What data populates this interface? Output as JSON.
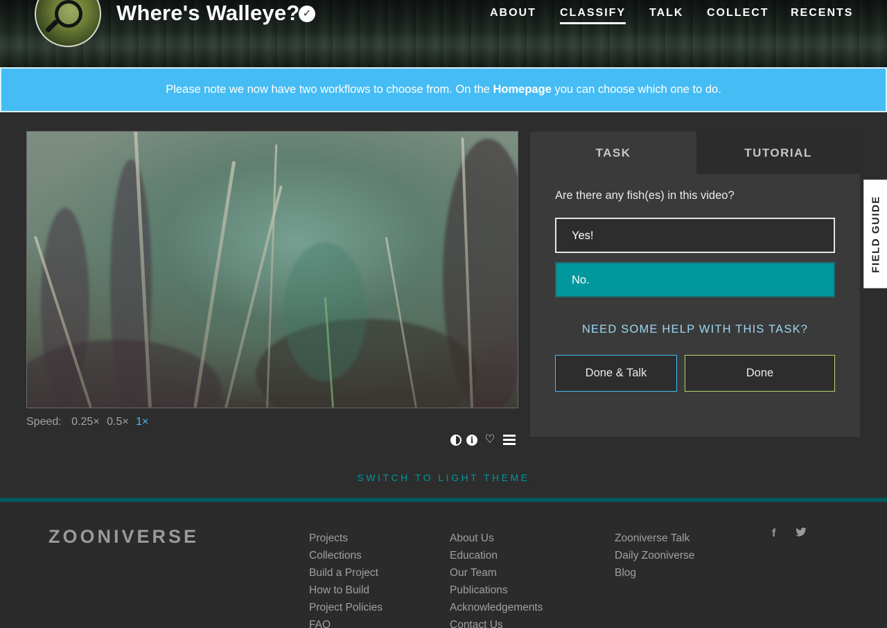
{
  "header": {
    "project_title": "Where's Walleye?",
    "nav": [
      "ABOUT",
      "CLASSIFY",
      "TALK",
      "COLLECT",
      "RECENTS"
    ],
    "active_nav": "CLASSIFY"
  },
  "banner": {
    "text_before": "Please note we now have two workflows to choose from. On the ",
    "link": "Homepage",
    "text_after": " you can choose which one to do."
  },
  "player": {
    "speed_label": "Speed:",
    "speeds": [
      "0.25×",
      "0.5×",
      "1×"
    ],
    "active_speed": "1×",
    "tools": [
      "contrast-icon",
      "info-icon",
      "heart-icon",
      "list-icon"
    ]
  },
  "task_panel": {
    "tabs": [
      "TASK",
      "TUTORIAL"
    ],
    "active_tab": "TASK",
    "question": "Are there any fish(es) in this video?",
    "answers": [
      "Yes!",
      "No."
    ],
    "selected_answer": "No.",
    "help_link": "NEED SOME HELP WITH THIS TASK?",
    "done_talk_label": "Done & Talk",
    "done_label": "Done"
  },
  "field_guide_label": "FIELD GUIDE",
  "theme_switch_label": "SWITCH TO LIGHT THEME",
  "footer": {
    "logo_text": "ZOONIVERSE",
    "col1": [
      "Projects",
      "Collections",
      "Build a Project",
      "How to Build",
      "Project Policies",
      "FAQ"
    ],
    "col2": [
      "About Us",
      "Education",
      "Our Team",
      "Publications",
      "Acknowledgements",
      "Contact Us"
    ],
    "col3": [
      "Zooniverse Talk",
      "Daily Zooniverse",
      "Blog"
    ],
    "social": [
      "facebook-icon",
      "twitter-icon"
    ]
  },
  "colors": {
    "banner": "#45bcf4",
    "selected_answer": "#00979d",
    "done_talk_border": "#45bcf4",
    "done_border": "#b6d66e",
    "footer_rule": "#00595d"
  }
}
